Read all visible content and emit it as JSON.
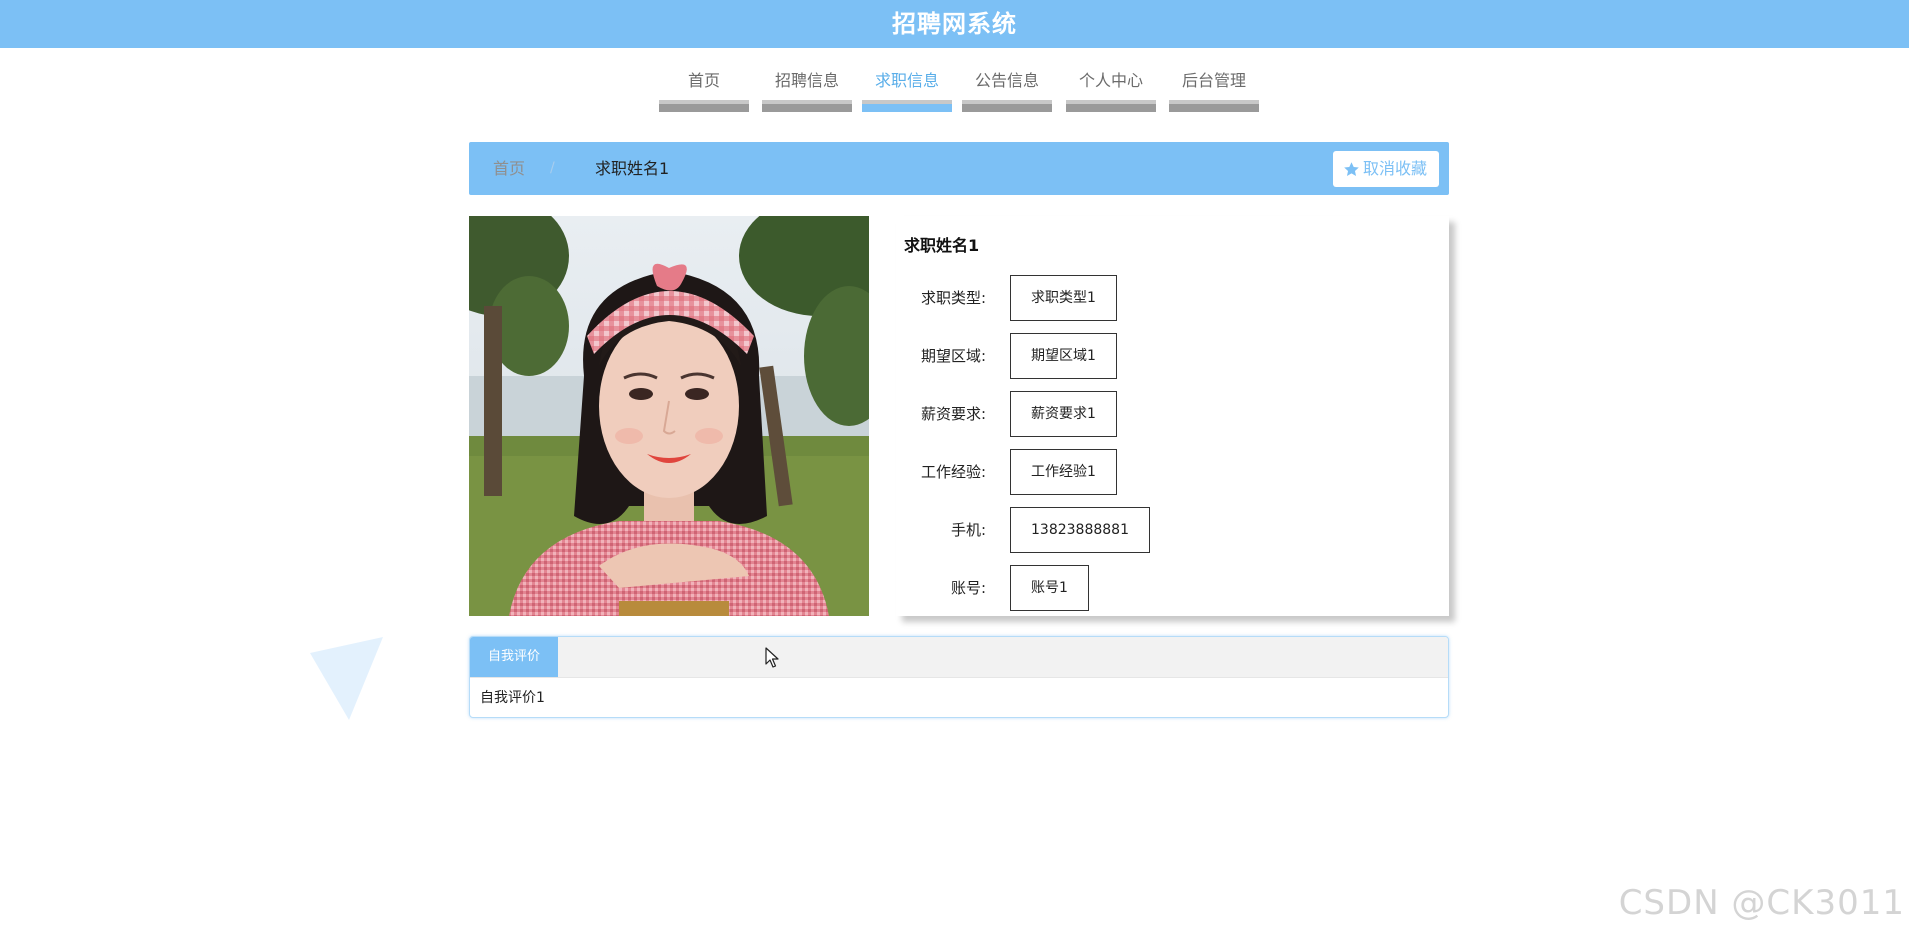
{
  "header": {
    "title": "招聘网系统"
  },
  "nav": {
    "items": [
      {
        "label": "首页",
        "active": false
      },
      {
        "label": "招聘信息",
        "active": false
      },
      {
        "label": "求职信息",
        "active": true
      },
      {
        "label": "公告信息",
        "active": false
      },
      {
        "label": "个人中心",
        "active": false
      },
      {
        "label": "后台管理",
        "active": false
      }
    ]
  },
  "breadcrumb": {
    "home": "首页",
    "separator": "/",
    "current": "求职姓名1"
  },
  "favorite": {
    "icon": "star-icon",
    "label": "取消收藏"
  },
  "detail": {
    "name": "求职姓名1",
    "fields": [
      {
        "label": "求职类型:",
        "value": "求职类型1"
      },
      {
        "label": "期望区域:",
        "value": "期望区域1"
      },
      {
        "label": "薪资要求:",
        "value": "薪资要求1"
      },
      {
        "label": "工作经验:",
        "value": "工作经验1"
      },
      {
        "label": "手机:",
        "value": "13823888881"
      },
      {
        "label": "账号:",
        "value": "账号1"
      }
    ]
  },
  "evaluation": {
    "tab_label": "自我评价",
    "content": "自我评价1"
  },
  "watermark": "CSDN @CK3011",
  "colors": {
    "primary": "#7cc0f5",
    "nav_text": "#6b6b6b",
    "nav_active_text": "#5aaee9",
    "white": "#ffffff"
  }
}
